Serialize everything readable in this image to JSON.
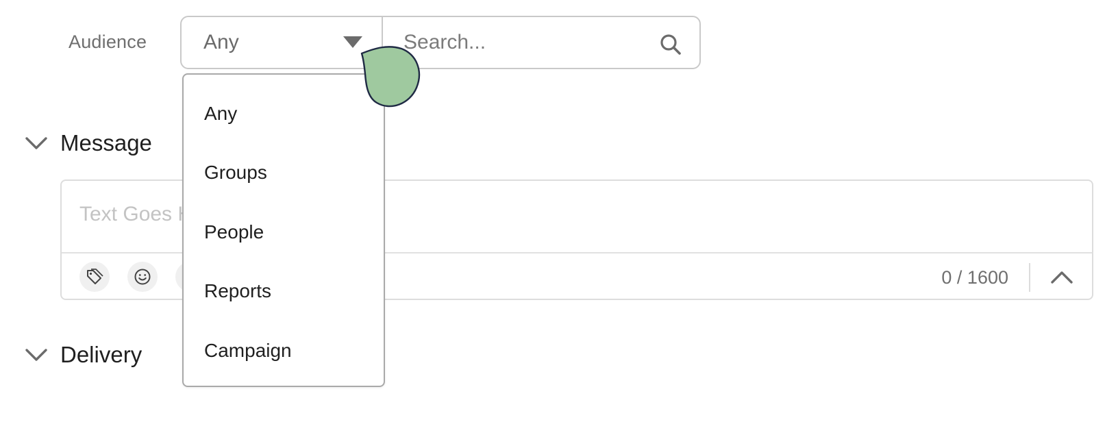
{
  "audience": {
    "label": "Audience",
    "selected": "Any",
    "search_placeholder": "Search..."
  },
  "dropdown": {
    "options": [
      "Any",
      "Groups",
      "People",
      "Reports",
      "Campaign"
    ]
  },
  "sections": {
    "message": {
      "title": "Message"
    },
    "delivery": {
      "title": "Delivery"
    }
  },
  "composer": {
    "placeholder": "Text Goes Here",
    "char_count": "0 / 1600"
  },
  "icons": {
    "search": "search-icon",
    "caret": "caret-down-icon",
    "section_chevron": "chevron-down-icon",
    "tag": "tag-icon",
    "emoji": "smiley-icon",
    "collapse": "chevron-up-icon",
    "pointer": "cursor-pointer-icon"
  },
  "colors": {
    "pointer_fill": "#9fc99f",
    "pointer_stroke": "#1f2a44",
    "border": "#c9c9c9",
    "muted_text": "#6f6f6f",
    "placeholder_text": "#c3c3c3"
  }
}
